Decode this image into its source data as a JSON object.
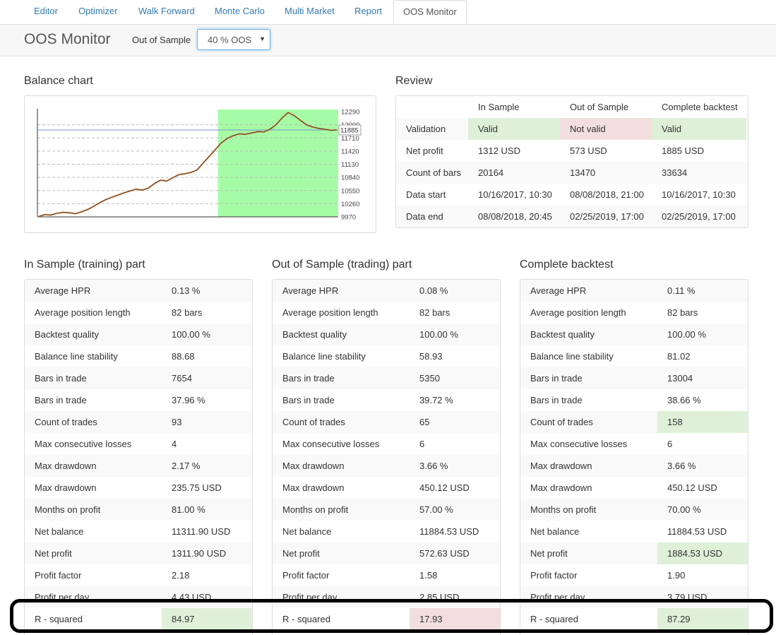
{
  "tabs": [
    {
      "label": "Editor"
    },
    {
      "label": "Optimizer"
    },
    {
      "label": "Walk Forward"
    },
    {
      "label": "Monte Carlo"
    },
    {
      "label": "Multi Market"
    },
    {
      "label": "Report"
    },
    {
      "label": "OOS Monitor"
    }
  ],
  "header": {
    "title": "OOS Monitor",
    "oos_label": "Out of Sample",
    "oos_selected": "40 % OOS"
  },
  "balance_chart": {
    "title": "Balance chart",
    "oos_color": "#a6fca6"
  },
  "chart_data": {
    "type": "line",
    "title": "",
    "ylim": [
      9970,
      12290
    ],
    "y_ticks": [
      12290,
      12000,
      11710,
      11420,
      11130,
      10840,
      10550,
      10260,
      9970
    ],
    "current_value": 11885,
    "oos_start_fraction": 0.6,
    "series": [
      {
        "values": [
          9980,
          10020,
          10010,
          10050,
          10070,
          10060,
          10040,
          10080,
          10130,
          10200,
          10280,
          10350,
          10400,
          10450,
          10500,
          10540,
          10580,
          10560,
          10600,
          10700,
          10780,
          10760,
          10830,
          10900,
          10920,
          10950,
          11000,
          11150,
          11300,
          11450,
          11600,
          11700,
          11760,
          11800,
          11790,
          11820,
          11850,
          11840,
          11900,
          12000,
          12150,
          12270,
          12200,
          12100,
          12000,
          11950,
          11920,
          11900,
          11880,
          11885
        ]
      }
    ]
  },
  "review": {
    "title": "Review",
    "headers": [
      "",
      "In Sample",
      "Out of Sample",
      "Complete backtest"
    ],
    "rows": [
      {
        "label": "Validation",
        "values": [
          "Valid",
          "Not valid",
          "Valid"
        ]
      },
      {
        "label": "Net profit",
        "values": [
          "1312 USD",
          "573 USD",
          "1885 USD"
        ]
      },
      {
        "label": "Count of bars",
        "values": [
          "20164",
          "13470",
          "33634"
        ]
      },
      {
        "label": "Data start",
        "values": [
          "10/16/2017, 10:30",
          "08/08/2018, 21:00",
          "10/16/2017, 10:30"
        ]
      },
      {
        "label": "Data end",
        "values": [
          "08/08/2018, 20:45",
          "02/25/2019, 17:00",
          "02/25/2019, 17:00"
        ]
      }
    ]
  },
  "stats": [
    {
      "title": "In Sample (training) part",
      "rows": [
        {
          "label": "Average HPR",
          "value": "0.13 %"
        },
        {
          "label": "Average position length",
          "value": "82 bars"
        },
        {
          "label": "Backtest quality",
          "value": "100.00 %"
        },
        {
          "label": "Balance line stability",
          "value": "88.68"
        },
        {
          "label": "Bars in trade",
          "value": "7654"
        },
        {
          "label": "Bars in trade",
          "value": "37.96 %"
        },
        {
          "label": "Count of trades",
          "value": "93"
        },
        {
          "label": "Max consecutive losses",
          "value": "4"
        },
        {
          "label": "Max drawdown",
          "value": "2.17 %"
        },
        {
          "label": "Max drawdown",
          "value": "235.75 USD"
        },
        {
          "label": "Months on profit",
          "value": "81.00 %"
        },
        {
          "label": "Net balance",
          "value": "11311.90 USD"
        },
        {
          "label": "Net profit",
          "value": "1311.90 USD"
        },
        {
          "label": "Profit factor",
          "value": "2.18"
        },
        {
          "label": "Profit per day",
          "value": "4.43 USD"
        },
        {
          "label": "R - squared",
          "value": "84.97",
          "status": "green"
        }
      ]
    },
    {
      "title": "Out of Sample (trading) part",
      "rows": [
        {
          "label": "Average HPR",
          "value": "0.08 %"
        },
        {
          "label": "Average position length",
          "value": "82 bars"
        },
        {
          "label": "Backtest quality",
          "value": "100.00 %"
        },
        {
          "label": "Balance line stability",
          "value": "58.93"
        },
        {
          "label": "Bars in trade",
          "value": "5350"
        },
        {
          "label": "Bars in trade",
          "value": "39.72 %"
        },
        {
          "label": "Count of trades",
          "value": "65"
        },
        {
          "label": "Max consecutive losses",
          "value": "6"
        },
        {
          "label": "Max drawdown",
          "value": "3.66 %"
        },
        {
          "label": "Max drawdown",
          "value": "450.12 USD"
        },
        {
          "label": "Months on profit",
          "value": "57.00 %"
        },
        {
          "label": "Net balance",
          "value": "11884.53 USD"
        },
        {
          "label": "Net profit",
          "value": "572.63 USD"
        },
        {
          "label": "Profit factor",
          "value": "1.58"
        },
        {
          "label": "Profit per day",
          "value": "2.85 USD"
        },
        {
          "label": "R - squared",
          "value": "17.93",
          "status": "red"
        }
      ]
    },
    {
      "title": "Complete backtest",
      "rows": [
        {
          "label": "Average HPR",
          "value": "0.11 %"
        },
        {
          "label": "Average position length",
          "value": "82 bars"
        },
        {
          "label": "Backtest quality",
          "value": "100.00 %"
        },
        {
          "label": "Balance line stability",
          "value": "81.02"
        },
        {
          "label": "Bars in trade",
          "value": "13004"
        },
        {
          "label": "Bars in trade",
          "value": "38.66 %"
        },
        {
          "label": "Count of trades",
          "value": "158",
          "status": "green"
        },
        {
          "label": "Max consecutive losses",
          "value": "6"
        },
        {
          "label": "Max drawdown",
          "value": "3.66 %"
        },
        {
          "label": "Max drawdown",
          "value": "450.12 USD"
        },
        {
          "label": "Months on profit",
          "value": "70.00 %"
        },
        {
          "label": "Net balance",
          "value": "11884.53 USD"
        },
        {
          "label": "Net profit",
          "value": "1884.53 USD",
          "status": "green"
        },
        {
          "label": "Profit factor",
          "value": "1.90"
        },
        {
          "label": "Profit per day",
          "value": "3.79 USD"
        },
        {
          "label": "R - squared",
          "value": "87.29",
          "status": "green"
        }
      ]
    }
  ]
}
